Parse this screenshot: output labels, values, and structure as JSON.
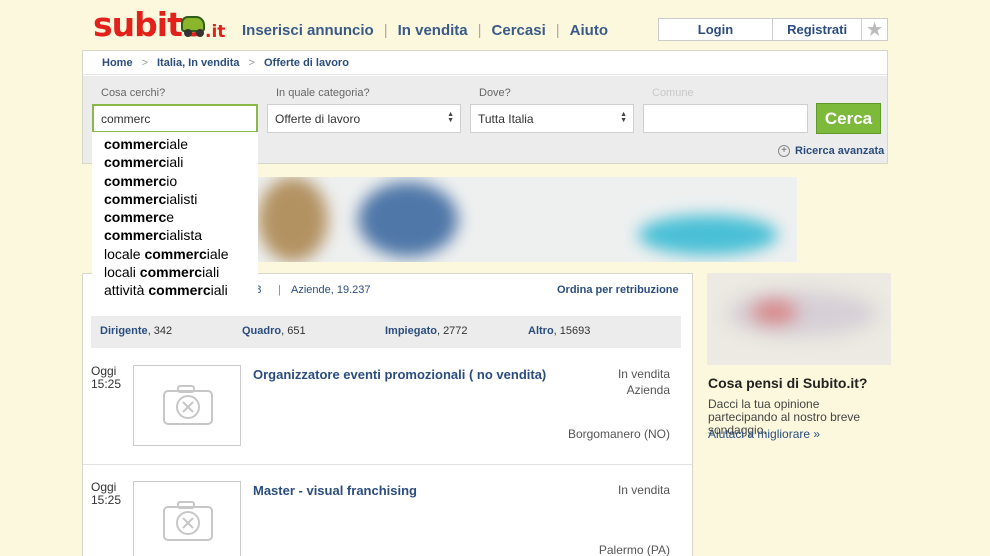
{
  "header": {
    "logo_text": "subito",
    "logo_tld": ".it",
    "nav": [
      "Inserisci annuncio",
      "In vendita",
      "Cercasi",
      "Aiuto"
    ],
    "login": "Login",
    "register": "Registrati",
    "favorites_icon": "star-icon"
  },
  "breadcrumb": {
    "home": "Home",
    "location": "Italia, In vendita",
    "category": "Offerte di lavoro"
  },
  "search": {
    "query_label": "Cosa cerchi?",
    "query_value": "commerc",
    "category_label": "In quale categoria?",
    "category_value": "Offerte di lavoro",
    "where_label": "Dove?",
    "where_value": "Tutta Italia",
    "comune_label": "Comune",
    "comune_value": "",
    "submit": "Cerca",
    "advanced": "Ricerca avanzata"
  },
  "suggestions": [
    {
      "pre": "",
      "match": "commerc",
      "post": "iale"
    },
    {
      "pre": "",
      "match": "commerc",
      "post": "iali"
    },
    {
      "pre": "",
      "match": "commerc",
      "post": "io"
    },
    {
      "pre": "",
      "match": "commerc",
      "post": "ialisti"
    },
    {
      "pre": "",
      "match": "commerc",
      "post": "e"
    },
    {
      "pre": "",
      "match": "commerc",
      "post": "ialista"
    },
    {
      "pre": "locale ",
      "match": "commerc",
      "post": "iale"
    },
    {
      "pre": "locali ",
      "match": "commerc",
      "post": "iali"
    },
    {
      "pre": "attività ",
      "match": "commerc",
      "post": "iali"
    }
  ],
  "listing": {
    "stat_partial": "228",
    "stat_sep": "|",
    "stat_companies": "Aziende, 19.237",
    "order": "Ordina per retribuzione",
    "categories": [
      {
        "name": "Dirigente",
        "count": ", 342"
      },
      {
        "name": "Quadro",
        "count": ", 651"
      },
      {
        "name": "Impiegato",
        "count": ", 2772"
      },
      {
        "name": "Altro",
        "count": ", 15693"
      }
    ],
    "items": [
      {
        "day": "Oggi",
        "time": "15:25",
        "title": "Organizzatore eventi promozionali ( no vendita)",
        "type": "In vendita",
        "advertiser": "Azienda",
        "location": "Borgomanero (NO)"
      },
      {
        "day": "Oggi",
        "time": "15:25",
        "title": "Master - visual franchising",
        "type": "In vendita",
        "advertiser": "",
        "location": "Palermo (PA)"
      }
    ]
  },
  "sidebar": {
    "title": "Cosa pensi di Subito.it?",
    "text": "Dacci la tua opinione partecipando al nostro breve sondaggio.",
    "link": "Aiutaci a migliorare »"
  },
  "colors": {
    "brand_red": "#e3211b",
    "link_blue": "#2b4d7e",
    "cta_green": "#7dba3c",
    "page_bg": "#fbf8dd"
  }
}
